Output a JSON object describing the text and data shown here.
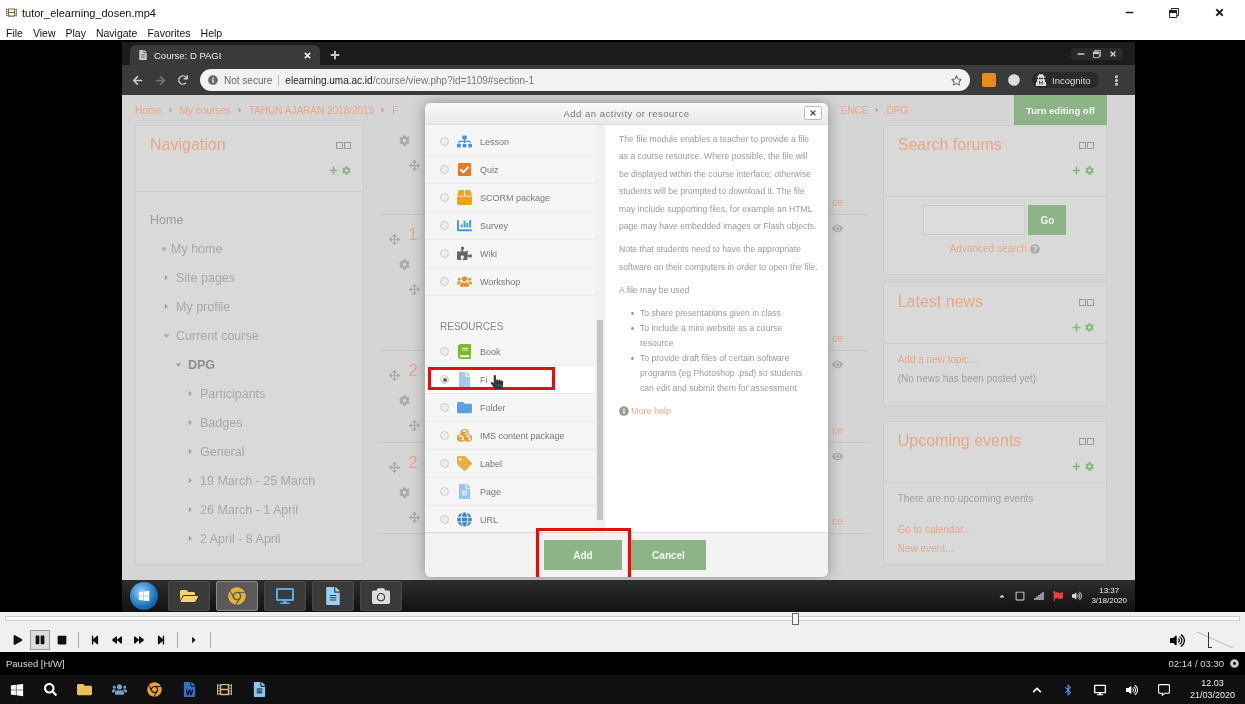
{
  "player": {
    "title": "tutor_elearning_dosen.mp4",
    "menu": [
      "File",
      "View",
      "Play",
      "Navigate",
      "Favorites",
      "Help"
    ],
    "seek": {
      "level": 0.64
    },
    "controls": [
      {
        "kind": "play",
        "selected": false
      },
      {
        "kind": "pause",
        "selected": true
      },
      {
        "kind": "stop",
        "selected": false
      },
      {
        "kind": "previous",
        "selected": false
      },
      {
        "kind": "rewind",
        "selected": false
      },
      {
        "kind": "forward",
        "selected": false
      },
      {
        "kind": "next",
        "selected": false
      },
      {
        "kind": "step",
        "selected": false
      }
    ],
    "volume": {
      "level": 0.3
    },
    "status": "Paused [H/W]",
    "time": "02:14 / 03:30"
  },
  "browser": {
    "tab": "Course: D PAGI",
    "security": "Not secure",
    "url": "**elearning.uma.ac.id**/course/view.php?id=1109#section-1",
    "profile": "Incognito"
  },
  "page": {
    "breadcrumb_left": [
      "Home",
      "My courses",
      "TAHUN AJARAN 2018/2019",
      "F"
    ],
    "breadcrumb_right": [
      "ENCE",
      "DPG"
    ],
    "edit_button": "Turn editing off",
    "navigation": {
      "title": "Navigation",
      "items": [
        {
          "kind": "plain",
          "label": "Home",
          "current": false,
          "children": [
            {
              "kind": "bullet",
              "label": "My home",
              "current": false
            },
            {
              "kind": "branch",
              "label": "Site pages",
              "expanded": false,
              "current": false
            },
            {
              "kind": "branch",
              "label": "My profile",
              "expanded": false,
              "current": false
            },
            {
              "kind": "branch",
              "label": "Current course",
              "expanded": true,
              "current": false,
              "children": [
                {
                  "kind": "branch",
                  "label": "DPG",
                  "expanded": true,
                  "current": true,
                  "children": [
                    {
                      "kind": "branch",
                      "label": "Participants",
                      "expanded": false,
                      "current": false
                    },
                    {
                      "kind": "branch",
                      "label": "Badges",
                      "expanded": false,
                      "current": false
                    },
                    {
                      "kind": "branch",
                      "label": "General",
                      "expanded": false,
                      "current": false
                    },
                    {
                      "kind": "branch",
                      "label": "19 March - 25 March",
                      "expanded": false,
                      "current": false
                    },
                    {
                      "kind": "branch",
                      "label": "26 March - 1 April",
                      "expanded": false,
                      "current": false
                    },
                    {
                      "kind": "branch",
                      "label": "2 April - 8 April",
                      "expanded": false,
                      "current": false
                    }
                  ]
                }
              ]
            }
          ]
        }
      ]
    },
    "sections": [
      {
        "link": "ce"
      },
      {
        "number": "1",
        "link": "ce"
      },
      {
        "number": "2",
        "link": "ce"
      },
      {
        "number": "2",
        "link": "ce"
      }
    ],
    "blocks": [
      {
        "kind": "search",
        "title": "Search forums",
        "button": "Go",
        "link": "Advanced search"
      },
      {
        "kind": "news",
        "title": "Latest news",
        "link": "Add a new topic...",
        "note": "(No news has been posted yet)"
      },
      {
        "kind": "events",
        "title": "Upcoming events",
        "note": "There are no upcoming events",
        "links": [
          "Go to calendar...",
          "New event..."
        ]
      }
    ]
  },
  "modal": {
    "title": "Add an activity or resource",
    "items": [
      {
        "kind": "lesson",
        "label": "Lesson",
        "selected": false,
        "highlighted": false
      },
      {
        "kind": "quiz",
        "label": "Quiz",
        "selected": false,
        "highlighted": false
      },
      {
        "kind": "scorm",
        "label": "SCORM package",
        "selected": false,
        "highlighted": false
      },
      {
        "kind": "survey",
        "label": "Survey",
        "selected": false,
        "highlighted": false
      },
      {
        "kind": "wiki",
        "label": "Wiki",
        "selected": false,
        "highlighted": false
      },
      {
        "kind": "workshop",
        "label": "Workshop",
        "selected": false,
        "highlighted": false
      },
      {
        "kind": "heading",
        "label": "RESOURCES"
      },
      {
        "kind": "book",
        "label": "Book",
        "selected": false,
        "highlighted": false
      },
      {
        "kind": "file",
        "label": "Fi",
        "selected": true,
        "highlighted": true
      },
      {
        "kind": "folder",
        "label": "Folder",
        "selected": false,
        "highlighted": false
      },
      {
        "kind": "ims",
        "label": "IMS content package",
        "selected": false,
        "highlighted": false
      },
      {
        "kind": "label",
        "label": "Label",
        "selected": false,
        "highlighted": false
      },
      {
        "kind": "page",
        "label": "Page",
        "selected": false,
        "highlighted": false
      },
      {
        "kind": "url",
        "label": "URL",
        "selected": false,
        "highlighted": false
      }
    ],
    "paragraphs": [
      "The file module enables a teacher to provide a file as a course resource. Where possible, the file will be displayed within the course interface; otherwise students will be prompted to download it. The file may include supporting files, for example an HTML page may have embedded images or Flash objects.",
      "Note that students need to have the appropriate software on their computers in order to open the file.",
      "A file may be used"
    ],
    "bullets": [
      "To share presentations given in class",
      "To include a mini website as a course resource",
      "To provide draft files of certain software programs (eg Photoshop .psd) so students can edit and submit them for assessment"
    ],
    "help": "More help",
    "buttons": [
      {
        "label": "Add",
        "highlighted": true
      },
      {
        "label": "Cancel",
        "highlighted": false
      }
    ]
  },
  "video_taskbar": {
    "apps": [
      {
        "kind": "explorer",
        "selected": false
      },
      {
        "kind": "chrome",
        "selected": true
      },
      {
        "kind": "remote",
        "selected": false
      },
      {
        "kind": "notes",
        "selected": false
      },
      {
        "kind": "obs",
        "selected": false
      }
    ],
    "time": "13:37",
    "date": "3/18/2020"
  },
  "taskbar": {
    "apps": [
      {
        "kind": "explorer"
      },
      {
        "kind": "people"
      },
      {
        "kind": "chrome"
      },
      {
        "kind": "word"
      },
      {
        "kind": "media"
      },
      {
        "kind": "notes"
      }
    ],
    "time": "12.03",
    "date": "21/03/2020"
  }
}
